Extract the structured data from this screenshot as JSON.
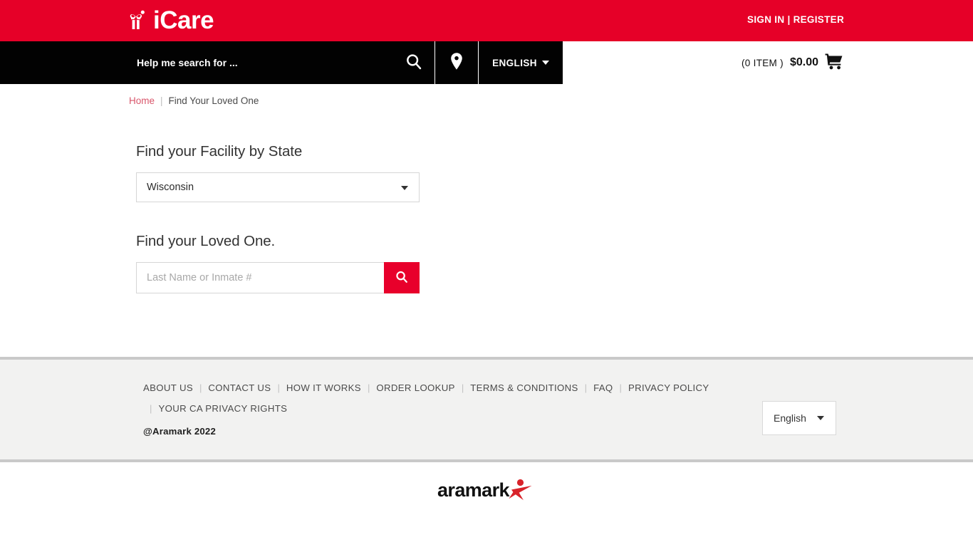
{
  "header": {
    "logo_text": "iCare",
    "logo_icon": "gift-butterfly-icon",
    "account_links": "SIGN IN | REGISTER",
    "brand_red": "#E60028"
  },
  "navbar": {
    "search_placeholder": "Help me search for ...",
    "search_value": "",
    "search_icon": "search-icon",
    "location_icon": "map-pin-icon",
    "language": "ENGLISH",
    "language_caret": "chevron-down-icon",
    "cart_count": "(0 ITEM )",
    "cart_total": "$0.00",
    "cart_icon": "shopping-cart-icon"
  },
  "breadcrumb": {
    "home": "Home",
    "separator": "|",
    "current": "Find Your Loved One"
  },
  "main": {
    "state_heading": "Find your Facility by State",
    "state_selected": "Wisconsin",
    "state_options": [
      "Wisconsin"
    ],
    "loved_one_heading": "Find your Loved One.",
    "inmate_placeholder": "Last Name or Inmate #",
    "inmate_value": "",
    "search_button_icon": "search-icon",
    "search_button_color": "#E8002B"
  },
  "footer": {
    "links": [
      "ABOUT US",
      "CONTACT US",
      "HOW IT WORKS",
      "ORDER LOOKUP",
      "TERMS & CONDITIONS",
      "FAQ",
      "PRIVACY POLICY",
      "YOUR CA PRIVACY RIGHTS"
    ],
    "copyright": "@Aramark 2022",
    "language_selected": "English",
    "language_options": [
      "English"
    ],
    "brand_logo_text": "aramark",
    "brand_logo_icon": "aramark-star-icon"
  }
}
